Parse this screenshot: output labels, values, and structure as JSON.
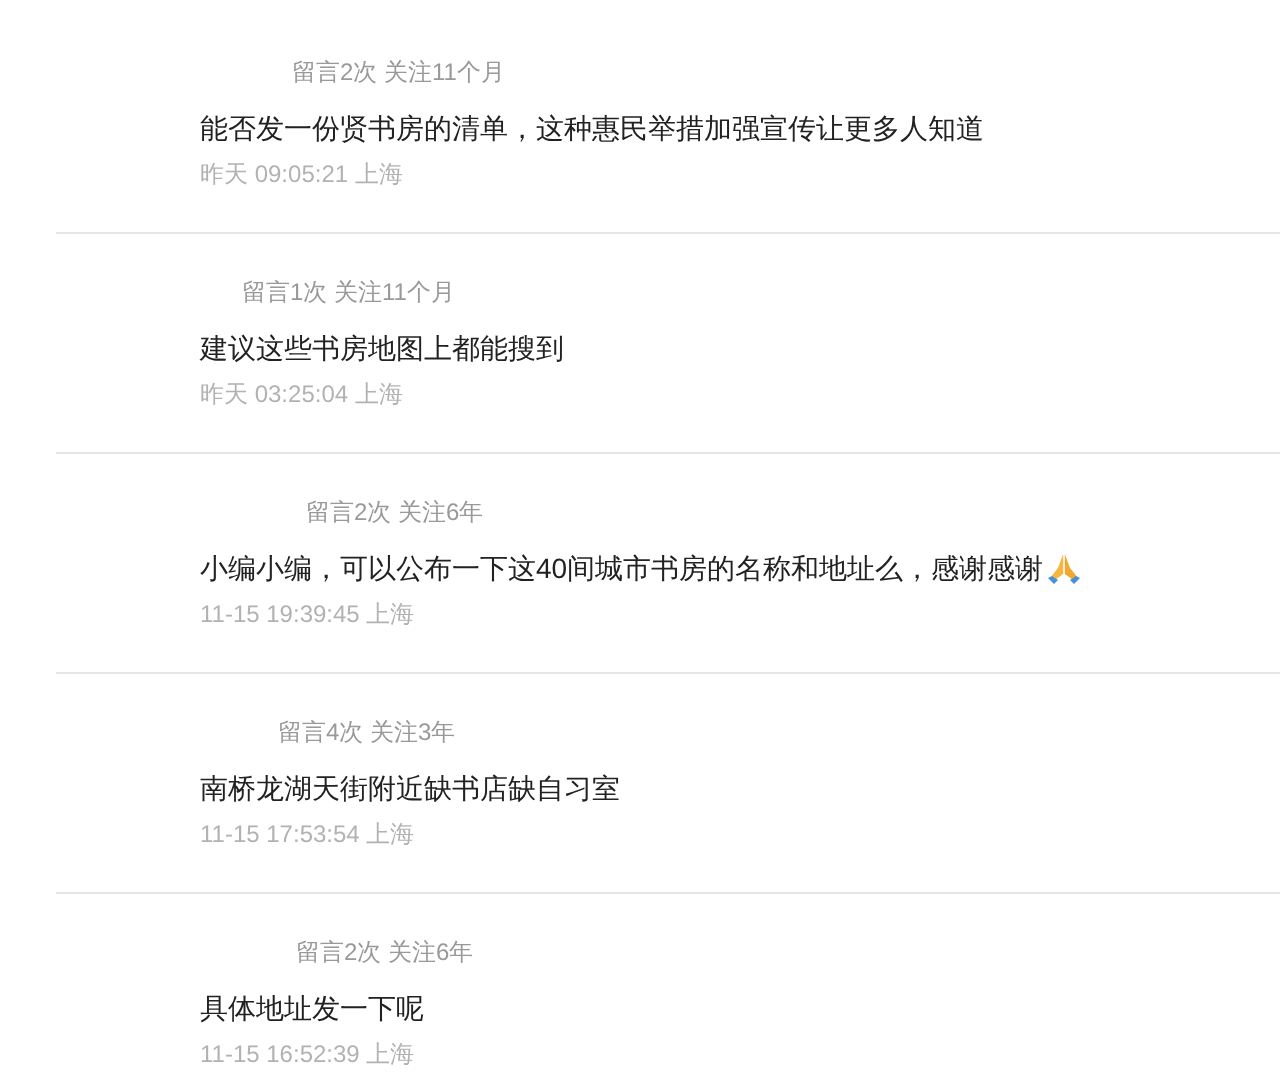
{
  "comments": [
    {
      "meta": "留言2次 关注11个月",
      "text": "能否发一份贤书房的清单，这种惠民举措加强宣传让更多人知道",
      "emoji": false,
      "time": "昨天 09:05:21 上海"
    },
    {
      "meta": "留言1次 关注11个月",
      "text": "建议这些书房地图上都能搜到",
      "emoji": false,
      "time": "昨天 03:25:04 上海"
    },
    {
      "meta": "留言2次 关注6年",
      "text": "小编小编，可以公布一下这40间城市书房的名称和地址么，感谢感谢",
      "emoji": true,
      "time": "11-15 19:39:45 上海"
    },
    {
      "meta": "留言4次 关注3年",
      "text": "南桥龙湖天街附近缺书店缺自习室",
      "emoji": false,
      "time": "11-15 17:53:54 上海"
    },
    {
      "meta": "留言2次 关注6年",
      "text": "具体地址发一下呢",
      "emoji": false,
      "time": "11-15 16:52:39 上海"
    }
  ]
}
